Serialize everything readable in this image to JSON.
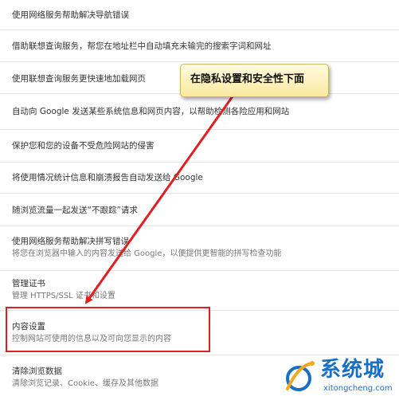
{
  "settings": {
    "items": [
      {
        "label": "使用网络服务帮助解决导航错误"
      },
      {
        "label": "借助联想查询服务，帮您在地址栏中自动填充未输完的搜索字词和网址"
      },
      {
        "label": "使用联想查询服务更快速地加载网页"
      },
      {
        "label": "自动向 Google 发送某些系统信息和网页内容，以帮助检测各险应用和网站"
      },
      {
        "label": "保护您和您的设备不受危险网站的侵害"
      },
      {
        "label": "将使用情况统计信息和崩溃报告自动发送给 Google"
      },
      {
        "label": "随浏览流量一起发送“不跟踪”请求"
      },
      {
        "label": "使用网络服务帮助解决拼写错误",
        "sub": "将您在浏览器中输入的内容发送给 Google，以便提供更智能的拼写检查功能"
      },
      {
        "label": "管理证书",
        "sub": "管理 HTTPS/SSL 证书和设置"
      },
      {
        "label": "内容设置",
        "sub": "控制网站可使用的信息以及可向您显示的内容"
      },
      {
        "label": "清除浏览数据",
        "sub": "清除浏览记录、Cookie、缓存及其他数据"
      }
    ]
  },
  "annotation": {
    "callout_text": "在隐私设置和安全性下面",
    "color": "#e02020"
  },
  "watermark": {
    "title": "系统城",
    "url": "xitongcheng.com"
  }
}
